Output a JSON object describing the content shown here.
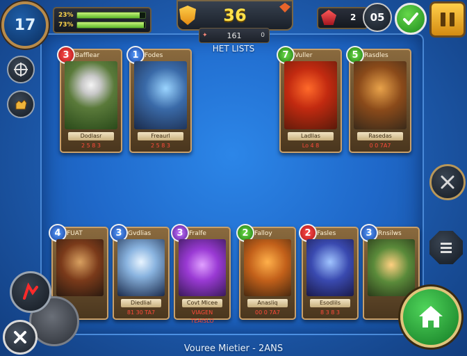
{
  "hud": {
    "level": "17",
    "stats": [
      {
        "label": "23%",
        "fill": 0.92
      },
      {
        "label": "73%",
        "fill": 0.98
      }
    ],
    "score": "36",
    "deck_left": "✦",
    "deck_count": "161",
    "deck_right": "0",
    "deck_title": "HET LISTS",
    "crystals": "2",
    "round": "05"
  },
  "opponent_cards": [
    {
      "cost": "3",
      "cost_color": "red",
      "title": "Bafflear",
      "plate": "Dodlasr",
      "stats": "2 5 8 3"
    },
    {
      "cost": "1",
      "cost_color": "blue",
      "title": "Fodes",
      "plate": "Freaurl",
      "stats": "2 5 8 3"
    },
    {
      "cost": "7",
      "cost_color": "green",
      "title": "Vuller",
      "plate": "Ladllas",
      "stats": "Lo 4 8"
    },
    {
      "cost": "5",
      "cost_color": "green",
      "title": "Rasdles",
      "plate": "Rasedas",
      "stats": "0 0 7A7"
    }
  ],
  "hand_cards": [
    {
      "cost": "4",
      "cost_color": "blue",
      "title": "FUAT",
      "plate": "",
      "stats": ""
    },
    {
      "cost": "3",
      "cost_color": "blue",
      "title": "Gvdlias",
      "plate": "Diedlial",
      "stats": "81 30 TA7"
    },
    {
      "cost": "3",
      "cost_color": "purple",
      "title": "Fralfe",
      "plate": "Covt Mlcee",
      "stats": "VIAGEN TEAISLO"
    },
    {
      "cost": "2",
      "cost_color": "green",
      "title": "Falloy",
      "plate": "Anasliq",
      "stats": "00 0 7A7"
    },
    {
      "cost": "2",
      "cost_color": "red",
      "title": "Fasles",
      "plate": "Esodlils",
      "stats": "8 3 8 3"
    },
    {
      "cost": "3",
      "cost_color": "blue",
      "title": "Rnsilws",
      "plate": "",
      "stats": ""
    }
  ],
  "footer": {
    "status_text": "Vouree Mietier - 2ANS"
  },
  "colors": {
    "board": "#1f68c9",
    "gold_frame": "#c9a06a",
    "score": "#ffe14a",
    "confirm": "#2cad2c",
    "home": "#22a33a"
  }
}
